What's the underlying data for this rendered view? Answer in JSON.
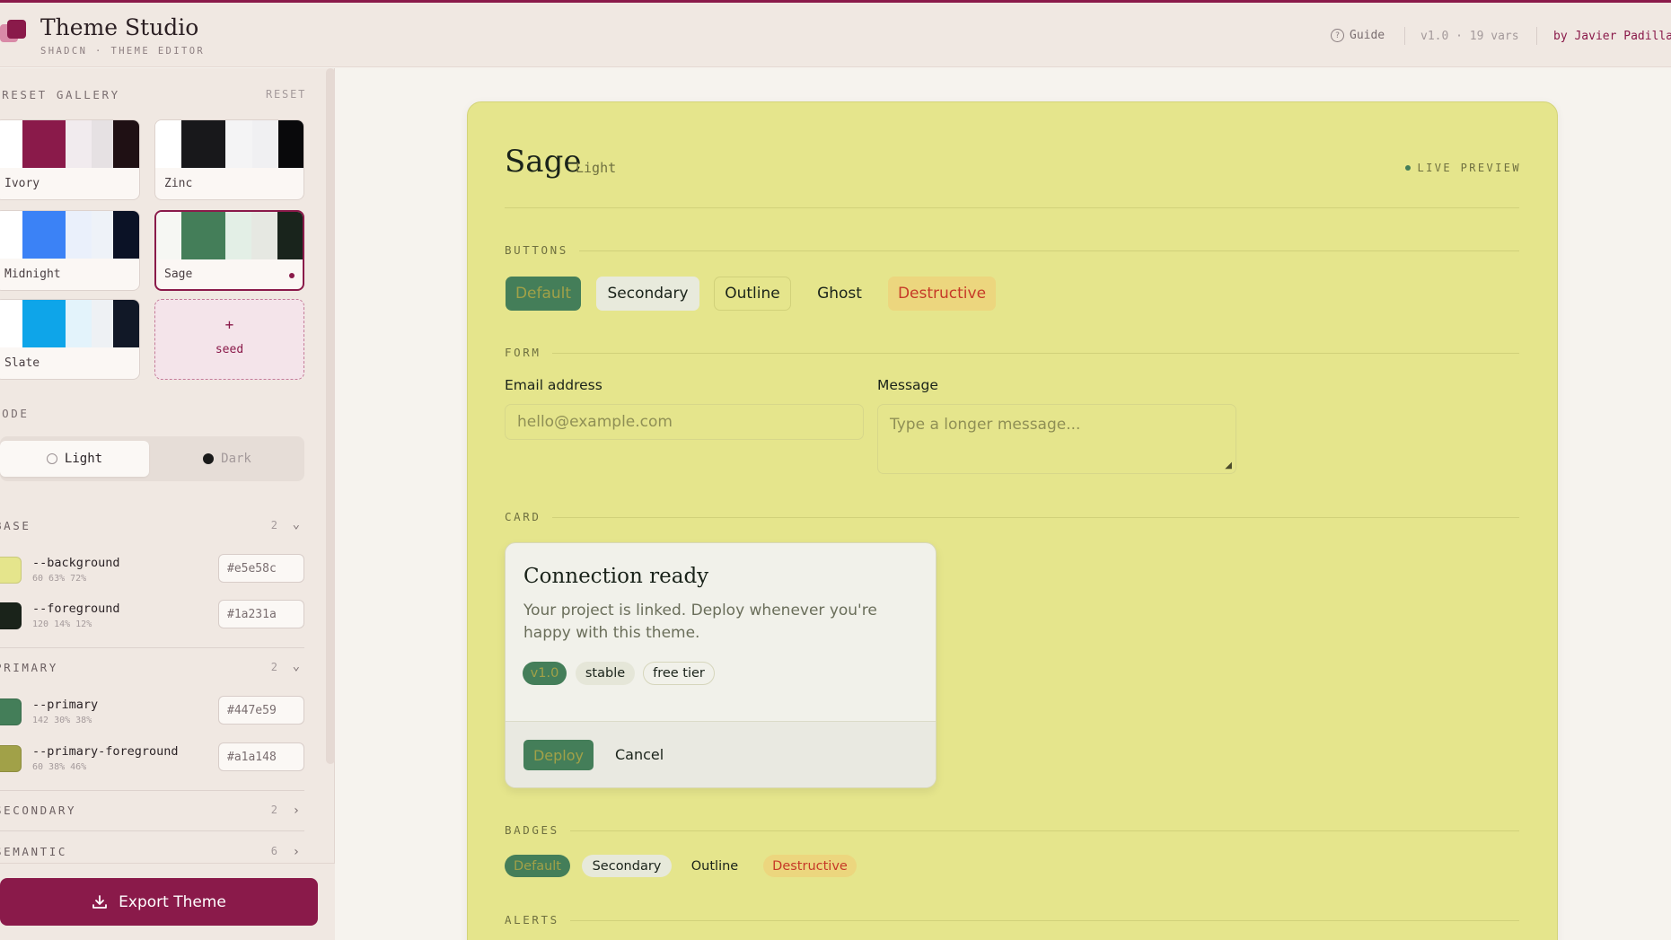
{
  "app": {
    "title": "Theme Studio",
    "subtitle": "SHADCN · THEME EDITOR",
    "guide_label": "Guide",
    "version": "v1.0 · 19 vars",
    "byline": "by Javier Padilla",
    "accent_color": "#8a1a4a"
  },
  "sidebar": {
    "gallery_label": "PRESET GALLERY",
    "reset_label": "RESET",
    "presets": [
      {
        "name": "Ivory",
        "colors": [
          "#ffffff",
          "#8a1a4a",
          "#f1ebee",
          "#e6e1e3",
          "#1f1014"
        ]
      },
      {
        "name": "Zinc",
        "colors": [
          "#ffffff",
          "#18181b",
          "#f4f4f5",
          "#f0f0f2",
          "#09090b"
        ]
      },
      {
        "name": "Midnight",
        "colors": [
          "#ffffff",
          "#3b82f6",
          "#eaf0fb",
          "#eef2f8",
          "#0b1226"
        ]
      },
      {
        "name": "Sage",
        "colors": [
          "#f6f7f3",
          "#447e59",
          "#e3efe6",
          "#e6e8e2",
          "#19241c"
        ],
        "selected": true
      },
      {
        "name": "Slate",
        "colors": [
          "#ffffff",
          "#0ea5e9",
          "#e3f3fb",
          "#eef1f4",
          "#111827"
        ]
      }
    ],
    "seed": {
      "plus": "+",
      "label": "seed"
    },
    "mode_label": "MODE",
    "mode": {
      "light": "Light",
      "dark": "Dark",
      "selected": "light"
    },
    "groups": {
      "base": {
        "label": "BASE",
        "count": "2",
        "vars": [
          {
            "name": "--background",
            "hsl": "60 63% 72%",
            "hex": "#e5e58c",
            "color": "#e5e58c"
          },
          {
            "name": "--foreground",
            "hsl": "120 14% 12%",
            "hex": "#1a231a",
            "color": "#1a231a"
          }
        ]
      },
      "primary": {
        "label": "PRIMARY",
        "count": "2",
        "vars": [
          {
            "name": "--primary",
            "hsl": "142 30% 38%",
            "hex": "#447e59",
            "color": "#447e59"
          },
          {
            "name": "--primary-foreground",
            "hsl": "60 38% 46%",
            "hex": "#a1a148",
            "color": "#a1a148"
          }
        ]
      },
      "secondary": {
        "label": "SECONDARY",
        "count": "2"
      },
      "semantic": {
        "label": "SEMANTIC",
        "count": "6"
      }
    },
    "export_label": "Export Theme"
  },
  "preview": {
    "theme_name": "Sage",
    "theme_mode": "Light",
    "live_label": "LIVE PREVIEW",
    "sections": {
      "buttons": "BUTTONS",
      "form": "FORM",
      "card": "CARD",
      "badges": "BADGES",
      "alerts": "ALERTS"
    },
    "buttons": {
      "default": "Default",
      "secondary": "Secondary",
      "outline": "Outline",
      "ghost": "Ghost",
      "destructive": "Destructive"
    },
    "form": {
      "email_label": "Email address",
      "email_placeholder": "hello@example.com",
      "message_label": "Message",
      "message_placeholder": "Type a longer message..."
    },
    "card": {
      "title": "Connection ready",
      "description": "Your project is linked. Deploy whenever you're happy with this theme.",
      "pills": [
        "v1.0",
        "stable",
        "free tier"
      ],
      "deploy_label": "Deploy",
      "cancel_label": "Cancel"
    },
    "badges": {
      "default": "Default",
      "secondary": "Secondary",
      "outline": "Outline",
      "destructive": "Destructive"
    }
  }
}
